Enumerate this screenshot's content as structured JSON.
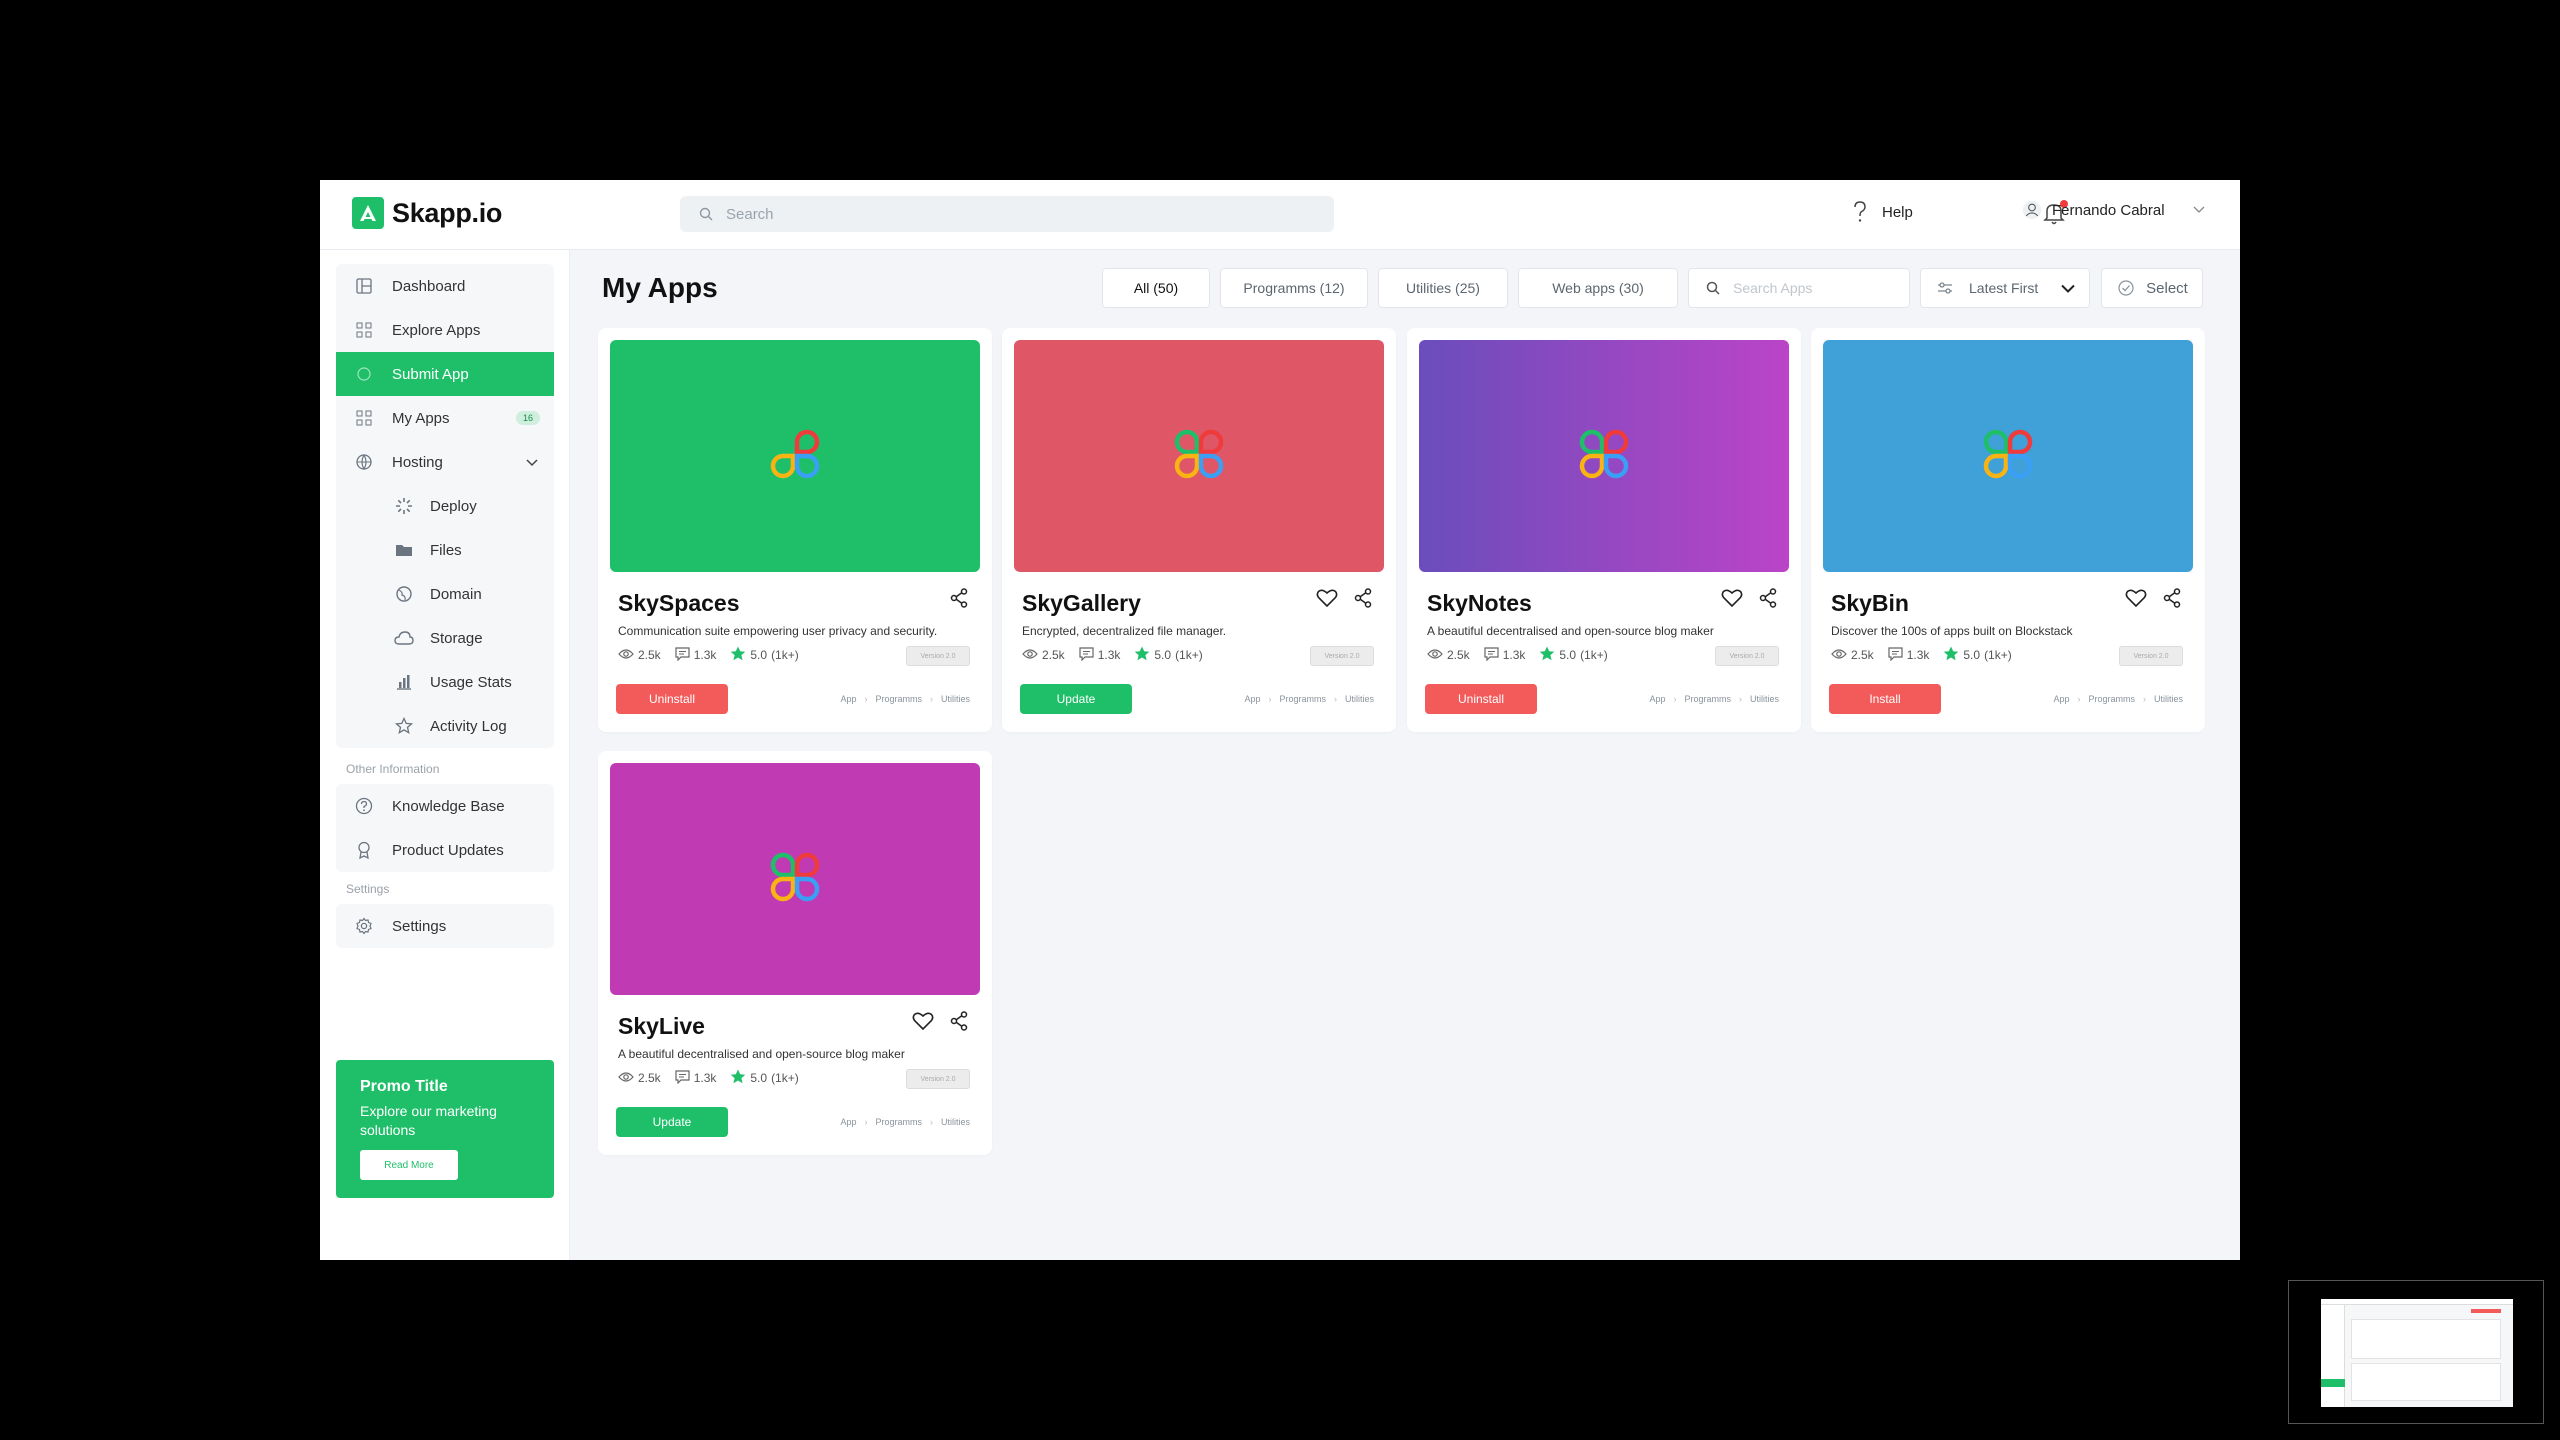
{
  "brand": {
    "name": "Skapp.io",
    "accent": "#1fbf6a"
  },
  "topbar": {
    "search_placeholder": "Search",
    "help_label": "Help",
    "user_name": "Fernando Cabral"
  },
  "sidebar": {
    "items": [
      {
        "label": "Dashboard",
        "icon": "dashboard-icon"
      },
      {
        "label": "Explore Apps",
        "icon": "grid-icon"
      },
      {
        "label": "Submit App",
        "icon": "submit-icon",
        "active": true
      },
      {
        "label": "My Apps",
        "icon": "grid-icon",
        "badge": "16"
      },
      {
        "label": "Hosting",
        "icon": "hosting-icon"
      }
    ],
    "hosting_items": [
      {
        "label": "Deploy",
        "icon": "deploy-icon"
      },
      {
        "label": "Files",
        "icon": "folder-icon"
      },
      {
        "label": "Domain",
        "icon": "globe-icon"
      },
      {
        "label": "Storage",
        "icon": "cloud-icon"
      },
      {
        "label": "Usage Stats",
        "icon": "bar-chart-icon"
      },
      {
        "label": "Activity Log",
        "icon": "star-icon"
      }
    ],
    "other_heading": "Other Information",
    "other_items": [
      {
        "label": "Knowledge Base",
        "icon": "help-circle-icon"
      },
      {
        "label": "Product Updates",
        "icon": "award-icon"
      }
    ],
    "settings_heading": "Settings",
    "settings_label": "Settings",
    "promo": {
      "title": "Promo Title",
      "desc": "Explore our marketing solutions",
      "button": "Read More"
    }
  },
  "main": {
    "title": "My Apps",
    "tabs": [
      {
        "label": "All (50)",
        "active": true
      },
      {
        "label": "Programms (12)"
      },
      {
        "label": "Utilities (25)"
      },
      {
        "label": "Web apps (30)"
      }
    ],
    "search_placeholder": "Search Apps",
    "sort_label": "Latest First",
    "select_label": "Select"
  },
  "apps": [
    {
      "name": "SkySpaces",
      "desc": "Communication suite empowering user privacy and security.",
      "views": "2.5k",
      "comments": "1.3k",
      "rating": "5.0",
      "reviews": "(1k+)",
      "version": "Version 2.0",
      "cta": "Uninstall",
      "cta_color": "red",
      "favorite": false,
      "banner": "#1fbf6a"
    },
    {
      "name": "SkyGallery",
      "desc": "Encrypted, decentralized file manager.",
      "views": "2.5k",
      "comments": "1.3k",
      "rating": "5.0",
      "reviews": "(1k+)",
      "version": "Version 2.0",
      "cta": "Update",
      "cta_color": "green",
      "favorite": true,
      "banner": "#df5767"
    },
    {
      "name": "SkyNotes",
      "desc": "A beautiful decentralised and open-source blog maker",
      "views": "2.5k",
      "comments": "1.3k",
      "rating": "5.0",
      "reviews": "(1k+)",
      "version": "Version 2.0",
      "cta": "Uninstall",
      "cta_color": "red",
      "favorite": true,
      "banner": "linear-gradient(90deg,#6a4dbb,#bb44c8)"
    },
    {
      "name": "SkyBin",
      "desc": "Discover the 100s of apps built on Blockstack",
      "views": "2.5k",
      "comments": "1.3k",
      "rating": "5.0",
      "reviews": "(1k+)",
      "version": "Version 2.0",
      "cta": "Install",
      "cta_color": "red",
      "favorite": true,
      "banner": "#3fa1d8"
    },
    {
      "name": "SkyLive",
      "desc": "A beautiful decentralised and open-source blog maker",
      "views": "2.5k",
      "comments": "1.3k",
      "rating": "5.0",
      "reviews": "(1k+)",
      "version": "Version 2.0",
      "cta": "Update",
      "cta_color": "green",
      "favorite": true,
      "banner": "#c03bb3"
    }
  ],
  "tags": [
    "App",
    "Programms",
    "Utilities"
  ]
}
